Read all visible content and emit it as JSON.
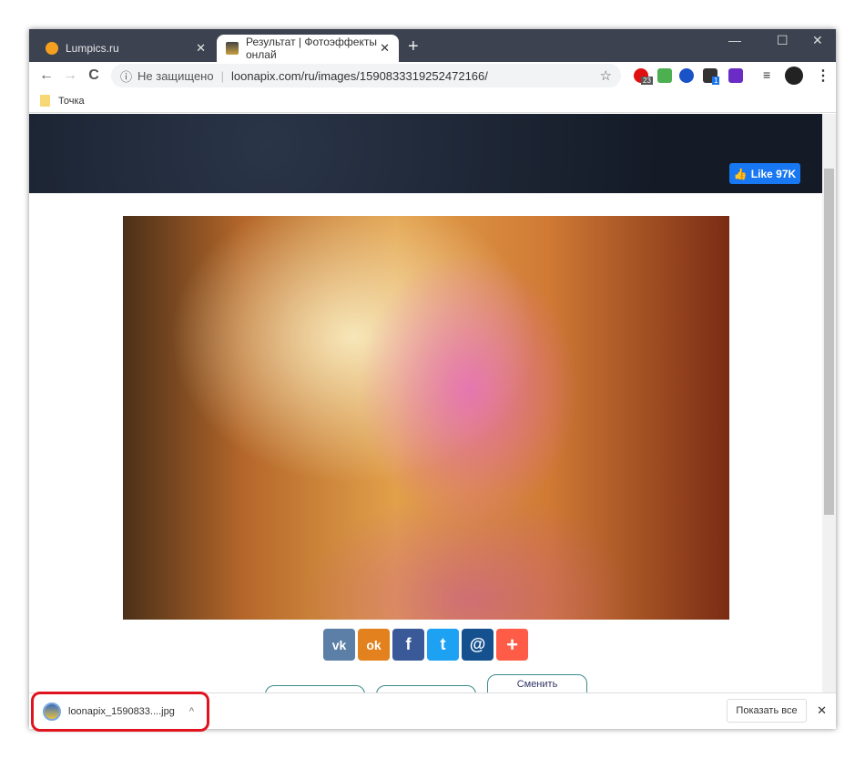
{
  "tabs": [
    {
      "title": "Lumpics.ru",
      "favicon_color": "#f5a020"
    },
    {
      "title": "Результат | Фотоэффекты онлай"
    }
  ],
  "new_tab": "+",
  "window_controls": {
    "minimize": "—",
    "maximize": "☐",
    "close": "✕"
  },
  "toolbar": {
    "back": "←",
    "forward": "→",
    "reload": "C",
    "security": "Не защищено",
    "url": "loonapix.com/ru/images/1590833319252472166/",
    "star": "☆",
    "menu": "⋮"
  },
  "extensions": [
    {
      "name": "ext-red",
      "color": "#e01010",
      "badge": "23"
    },
    {
      "name": "ext-music",
      "color": "#4caf50"
    },
    {
      "name": "ext-globe",
      "color": "#1a52c8"
    },
    {
      "name": "ext-box",
      "color": "#333",
      "badge": "1"
    },
    {
      "name": "ext-purple",
      "color": "#6a2cc4"
    }
  ],
  "bookmarks": [
    {
      "label": "Точка"
    }
  ],
  "page": {
    "like_label": "Like 97K",
    "share": [
      {
        "label": "vk",
        "glyph": "vk",
        "color": "#5b7fa6"
      },
      {
        "label": "ok",
        "glyph": "ok",
        "color": "#e2811d"
      },
      {
        "label": "facebook",
        "glyph": "f",
        "color": "#3a5998"
      },
      {
        "label": "twitter",
        "glyph": "t",
        "color": "#1da1f2"
      },
      {
        "label": "mail",
        "glyph": "@",
        "color": "#168de2"
      },
      {
        "label": "more",
        "glyph": "+",
        "color": "#ff5c48"
      }
    ],
    "buttons": [
      "",
      "",
      "Сменить"
    ]
  },
  "download": {
    "filename": "loonapix_1590833....jpg",
    "chevron": "^",
    "show_all": "Показать все",
    "close": "✕"
  }
}
